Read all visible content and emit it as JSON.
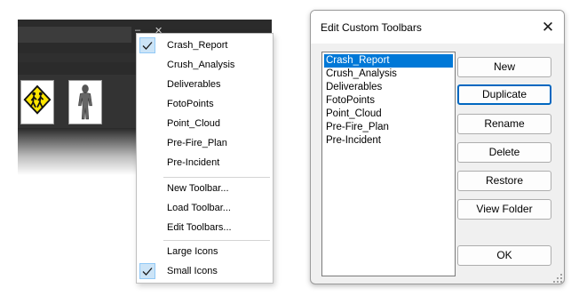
{
  "menu": {
    "toolbars": [
      {
        "label": "Crash_Report",
        "checked": true
      },
      {
        "label": "Crush_Analysis",
        "checked": false
      },
      {
        "label": "Deliverables",
        "checked": false
      },
      {
        "label": "FotoPoints",
        "checked": false
      },
      {
        "label": "Point_Cloud",
        "checked": false
      },
      {
        "label": "Pre-Fire_Plan",
        "checked": false
      },
      {
        "label": "Pre-Incident",
        "checked": false
      }
    ],
    "actions": [
      {
        "label": "New Toolbar..."
      },
      {
        "label": "Load Toolbar..."
      },
      {
        "label": "Edit Toolbars..."
      }
    ],
    "icon_sizes": [
      {
        "label": "Large Icons",
        "checked": false
      },
      {
        "label": "Small Icons",
        "checked": true
      }
    ]
  },
  "toolbar_icons": [
    "pedestrian-crossing-sign-icon",
    "human-figure-icon"
  ],
  "dialog": {
    "title": "Edit Custom Toolbars",
    "close_glyph": "✕",
    "list_items": [
      "Crash_Report",
      "Crush_Analysis",
      "Deliverables",
      "FotoPoints",
      "Point_Cloud",
      "Pre-Fire_Plan",
      "Pre-Incident"
    ],
    "selected_index": 0,
    "buttons": {
      "new": "New",
      "duplicate": "Duplicate",
      "rename": "Rename",
      "delete": "Delete",
      "restore": "Restore",
      "view_folder": "View Folder",
      "ok": "OK"
    }
  },
  "colors": {
    "selection": "#0078d7",
    "check_background": "#cce4f7",
    "focus_border": "#0067c0"
  }
}
